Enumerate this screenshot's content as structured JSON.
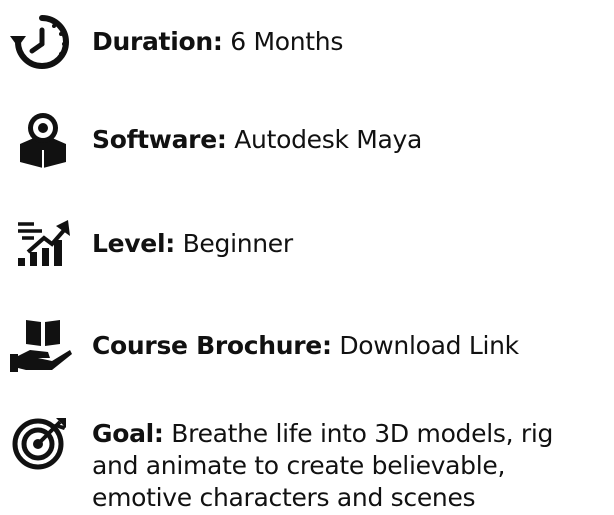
{
  "items": [
    {
      "icon": "clock-rewind-icon",
      "label": "Duration:",
      "value": "6 Months"
    },
    {
      "icon": "software-box-icon",
      "label": "Software:",
      "value": "Autodesk Maya"
    },
    {
      "icon": "level-chart-icon",
      "label": "Level:",
      "value": "Beginner"
    },
    {
      "icon": "book-hand-icon",
      "label": "Course Brochure:",
      "value": "Download Link"
    },
    {
      "icon": "target-icon",
      "label": "Goal:",
      "value_lines": [
        "Breathe life into 3D models, rig",
        "and animate to create believable,",
        "emotive characters and scenes"
      ]
    }
  ],
  "colors": {
    "text": "#111111",
    "background": "#ffffff"
  }
}
